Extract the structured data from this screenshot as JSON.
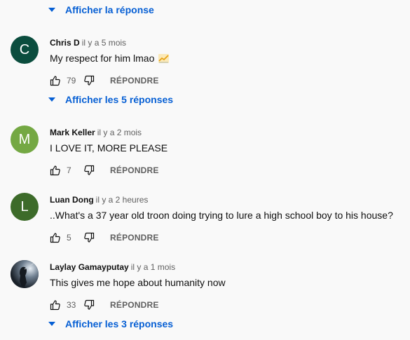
{
  "replies_toggles": [
    {
      "label": "Afficher la réponse"
    },
    {
      "label": "Afficher les 5 réponses"
    },
    {
      "label": "Afficher les 3 réponses"
    }
  ],
  "reply_label": "RÉPONDRE",
  "comments": [
    {
      "avatar_letter": "C",
      "avatar_color": "#0b4d3e",
      "author": "Chris D",
      "time": "il y a 5 mois",
      "text": "My respect for him lmao",
      "emoji": "chart-increasing-emoji",
      "likes": "79"
    },
    {
      "avatar_letter": "M",
      "avatar_color": "#74a843",
      "author": "Mark Keller",
      "time": "il y a 2 mois",
      "text": "I LOVE IT, MORE PLEASE",
      "likes": "7"
    },
    {
      "avatar_letter": "L",
      "avatar_color": "#3d6b2a",
      "author": "Luan Dong",
      "time": "il y a 2 heures",
      "text": "..What's a 37 year old troon doing trying to lure a high school boy to his house?",
      "likes": "5"
    },
    {
      "avatar_letter": "",
      "avatar_color": "#1c2530",
      "author": "Laylay Gamayputay",
      "time": "il y a 1 mois",
      "text": "This gives me hope about humanity now",
      "likes": "33"
    }
  ]
}
